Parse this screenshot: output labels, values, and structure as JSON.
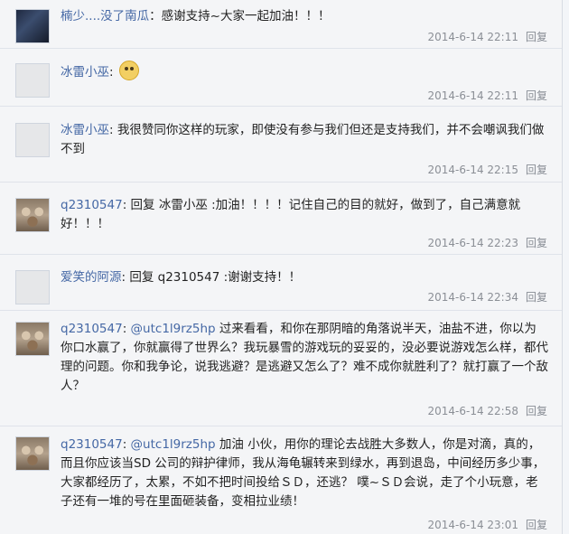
{
  "comments": [
    {
      "user": "楠少....没了南瓜",
      "text": "感谢支持~大家一起加油！！！",
      "time": "2014-6-14 22:11",
      "reply_label": "回复",
      "avatar_icon": "dark-avatar-icon"
    },
    {
      "user": "冰雷小巫",
      "text": "",
      "time": "2014-6-14 22:11",
      "reply_label": "回复",
      "avatar_icon": "default-avatar-icon",
      "emoji": "angry-face-icon"
    },
    {
      "user": "冰雷小巫",
      "text": "我很赞同你这样的玩家，即使没有参与我们但还是支持我们，并不会嘲讽我们做不到",
      "time": "2014-6-14 22:15",
      "reply_label": "回复",
      "avatar_icon": "default-avatar-icon"
    },
    {
      "user": "q2310547",
      "text": "回复 冰雷小巫 :加油！！！！记住自己的目的就好，做到了，自己满意就好！！！",
      "time": "2014-6-14 22:23",
      "reply_label": "回复",
      "avatar_icon": "cat-avatar-icon"
    },
    {
      "user": "爱笑的阿源",
      "text": "回复 q2310547 :谢谢支持！！",
      "time": "2014-6-14 22:34",
      "reply_label": "回复",
      "avatar_icon": "default-avatar-icon"
    },
    {
      "user": "q2310547",
      "mention": "@utc1l9rz5hp",
      "text": "过来看看，和你在那阴暗的角落说半天，油盐不进，你以为你口水赢了，你就赢得了世界么？我玩暴雪的游戏玩的妥妥的，没必要说游戏怎么样，都代理的问题。你和我争论，说我逃避？是逃避又怎么了？难不成你就胜利了？就打赢了一个敌人？",
      "time": "2014-6-14 22:58",
      "reply_label": "回复",
      "avatar_icon": "cat-avatar-icon"
    },
    {
      "user": "q2310547",
      "mention": "@utc1l9rz5hp",
      "text": "加油 小伙，用你的理论去战胜大多数人，你是对滴，真的，而且你应该当SD 公司的辩护律师，我从海龟辗转来到绿水，再到退岛，中间经历多少事，大家都经历了，太累，不如不把时间投给ＳＤ，还逃？ 噗~ＳＤ会说，走了个小玩意，老子还有一堆的号在里面砸装备，变相拉业绩！",
      "time": "2014-6-14 23:01",
      "reply_label": "回复",
      "avatar_icon": "cat-avatar-icon"
    }
  ]
}
